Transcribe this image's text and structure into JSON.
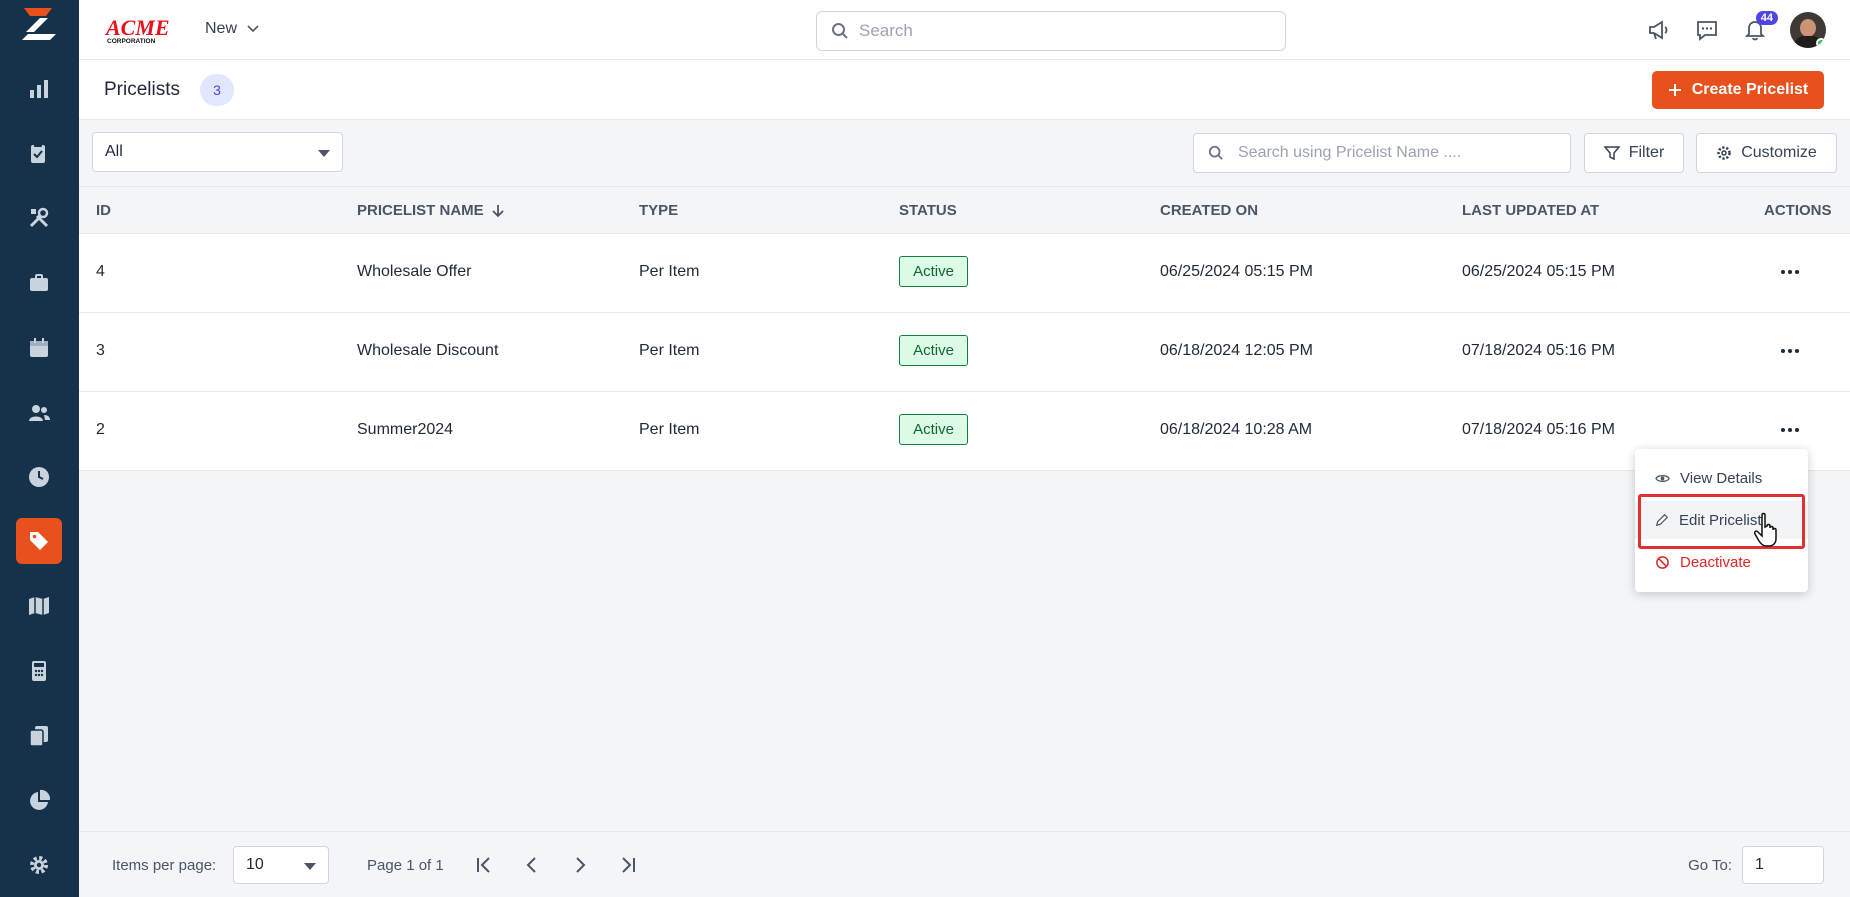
{
  "app": {
    "brand_name": "ACME CORPORATION",
    "brand_color": "#e8501e",
    "sidebar_color": "#15324a",
    "new_menu_label": "New",
    "search_placeholder": "Search",
    "notification_count": "44",
    "sidebar_items": [
      {
        "icon": "bar-chart-icon"
      },
      {
        "icon": "clipboard-check-icon"
      },
      {
        "icon": "tools-icon"
      },
      {
        "icon": "briefcase-icon"
      },
      {
        "icon": "calendar-icon"
      },
      {
        "icon": "users-icon"
      },
      {
        "icon": "clock-icon"
      },
      {
        "icon": "tag-icon",
        "active": true
      },
      {
        "icon": "map-icon"
      },
      {
        "icon": "calculator-icon"
      },
      {
        "icon": "documents-icon"
      },
      {
        "icon": "pie-chart-icon"
      },
      {
        "icon": "gear-icon"
      }
    ]
  },
  "page": {
    "title": "Pricelists",
    "count": "3",
    "create_label": "Create Pricelist"
  },
  "filters": {
    "status_select": "All",
    "search_placeholder": "Search using Pricelist Name ....",
    "filter_label": "Filter",
    "customize_label": "Customize"
  },
  "table": {
    "headers": {
      "id": "ID",
      "name": "PRICELIST NAME",
      "type": "TYPE",
      "status": "STATUS",
      "created": "CREATED ON",
      "updated": "LAST UPDATED AT",
      "actions": "ACTIONS"
    },
    "rows": [
      {
        "id": "4",
        "name": "Wholesale Offer",
        "type": "Per Item",
        "status": "Active",
        "created": "06/25/2024 05:15 PM",
        "updated": "06/25/2024 05:15 PM"
      },
      {
        "id": "3",
        "name": "Wholesale Discount",
        "type": "Per Item",
        "status": "Active",
        "created": "06/18/2024 12:05 PM",
        "updated": "07/18/2024 05:16 PM"
      },
      {
        "id": "2",
        "name": "Summer2024",
        "type": "Per Item",
        "status": "Active",
        "created": "06/18/2024 10:28 AM",
        "updated": "07/18/2024 05:16 PM"
      }
    ]
  },
  "menu": {
    "view": "View Details",
    "edit": "Edit Pricelist",
    "deactivate": "Deactivate"
  },
  "pagination": {
    "items_per_page_label": "Items per page:",
    "items_per_page": "10",
    "page_info": "Page 1 of 1",
    "goto_label": "Go To:",
    "goto_value": "1"
  }
}
